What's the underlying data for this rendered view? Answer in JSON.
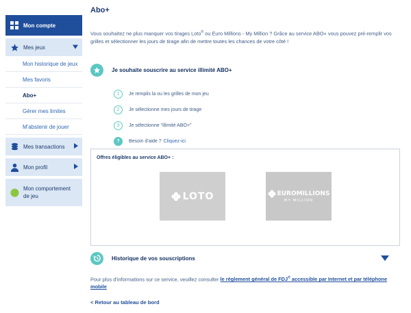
{
  "sidebar": {
    "header": {
      "label": "Mon compte",
      "icon": "grid-icon"
    },
    "groups": [
      {
        "label": "Mes jeux",
        "icon": "star-icon",
        "expanded": true
      },
      {
        "label": "Mes transactions",
        "icon": "coins-icon",
        "expanded": false
      },
      {
        "label": "Mon profil",
        "icon": "user-icon",
        "expanded": false
      },
      {
        "label": "Mon comportement de jeu",
        "icon": "green-dot-icon"
      }
    ],
    "sub_items": [
      {
        "label": "Mon historique de jeux"
      },
      {
        "label": "Mes favoris"
      },
      {
        "label": "Abo+",
        "active": true
      },
      {
        "label": "Gérer mes limites"
      },
      {
        "label": "M'abstenir de jouer"
      }
    ]
  },
  "main": {
    "title": "Abo+",
    "intro": {
      "part1": "Vous souhaitez ne plus manquer vos tirages Loto",
      "reg1": "®",
      "part2": " ou Euro Millions - My Million ? Grâce au service ABO+ vous pouvez pré-remplir vos grilles et sélectionner les jours de tirage afin de mettre toutes les chances de votre côté !"
    },
    "subscribe_title": "Je souhaite souscrire au service illimité ABO+",
    "steps": [
      {
        "num": "1",
        "text": "Je remplis la ou les grilles de mon jeu"
      },
      {
        "num": "2",
        "text": "Je sélectionne mes jours de tirage"
      },
      {
        "num": "3",
        "text": "Je sélectionne \"illimité ABO+\""
      }
    ],
    "help": {
      "icon_text": "?",
      "text": "Besoin d'aide ?",
      "link": "Cliquez-ici"
    },
    "offers": {
      "title": "Offres éligibles au service ABO+ :",
      "loto": {
        "brand": "LOTO"
      },
      "euro": {
        "brand": "EUROMILLIONS",
        "sub": "MY MILLION"
      }
    },
    "history_title": "Historique de vos souscriptions",
    "info": {
      "text": "Pour plus d'informations sur ce service, veuillez consulter ",
      "link1": "le règlement général de FDJ",
      "reg": "®",
      "link2": " accessible par Internet et par téléphone mobile"
    },
    "back_link": "< Retour au tableau de bord"
  },
  "colors": {
    "primary": "#1f4e9b",
    "accent": "#5cc7c3",
    "sidebar_bg": "#dbe7f5",
    "green": "#8cc63f"
  }
}
